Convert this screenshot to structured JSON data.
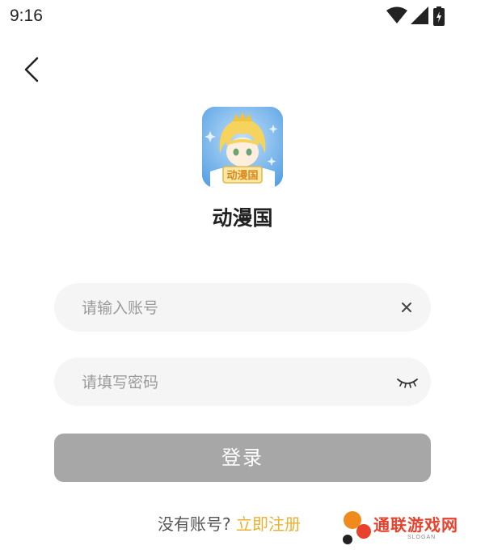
{
  "status_bar": {
    "time": "9:16",
    "icons": [
      "wifi-icon",
      "signal-icon",
      "battery-charging-icon"
    ]
  },
  "nav": {
    "back_icon": "chevron-left-icon"
  },
  "app": {
    "name": "动漫国",
    "logo_text": "动漫国"
  },
  "form": {
    "account": {
      "placeholder": "请输入账号",
      "value": "",
      "clear_icon": "close-icon"
    },
    "password": {
      "placeholder": "请填写密码",
      "value": "",
      "toggle_icon": "eye-closed-icon"
    },
    "login_label": "登录"
  },
  "register": {
    "prompt": "没有账号?",
    "link_label": "立即注册"
  },
  "watermark": {
    "text": "通联游戏网",
    "subtext": "SLOGAN"
  },
  "colors": {
    "accent": "#e9b131",
    "button_disabled": "#a7a7a7",
    "field_bg": "#f5f5f5",
    "watermark": "#e8412c"
  }
}
